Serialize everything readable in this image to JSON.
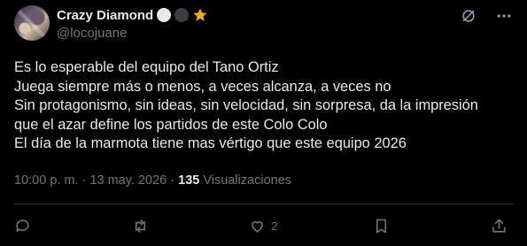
{
  "author": {
    "display_name": "Crazy Diamond",
    "handle": "@locojuane",
    "badges": [
      {
        "icon": "white-circle-emoji",
        "color": "#e7e9ea"
      },
      {
        "icon": "black-circle-emoji",
        "color": "#3b3f45"
      },
      {
        "icon": "star-emoji",
        "color": "#f5a623"
      }
    ]
  },
  "top_actions": [
    {
      "icon": "grok-icon"
    },
    {
      "icon": "more-options-icon"
    }
  ],
  "post": {
    "lines": [
      "Es lo esperable del equipo del Tano Ortiz",
      "Juega siempre más o menos, a veces alcanza, a veces no",
      "Sin protagonismo, sin ideas, sin velocidad, sin sorpresa, da la impresión",
      "que el azar define los partidos de este Colo Colo",
      "El día de la marmota tiene mas vértigo que este equipo 2026"
    ]
  },
  "meta": {
    "time": "10:00 p. m.",
    "separator1": " · ",
    "date": "13 may. 2026",
    "separator2": " · ",
    "views_count": "135",
    "views_label": " Visualizaciones"
  },
  "actions": {
    "reply": {
      "icon": "reply-icon",
      "count": ""
    },
    "repost": {
      "icon": "repost-icon",
      "count": ""
    },
    "like": {
      "icon": "heart-icon",
      "count": "2"
    },
    "bookmark": {
      "icon": "bookmark-icon",
      "count": ""
    },
    "share": {
      "icon": "share-icon",
      "count": ""
    }
  }
}
